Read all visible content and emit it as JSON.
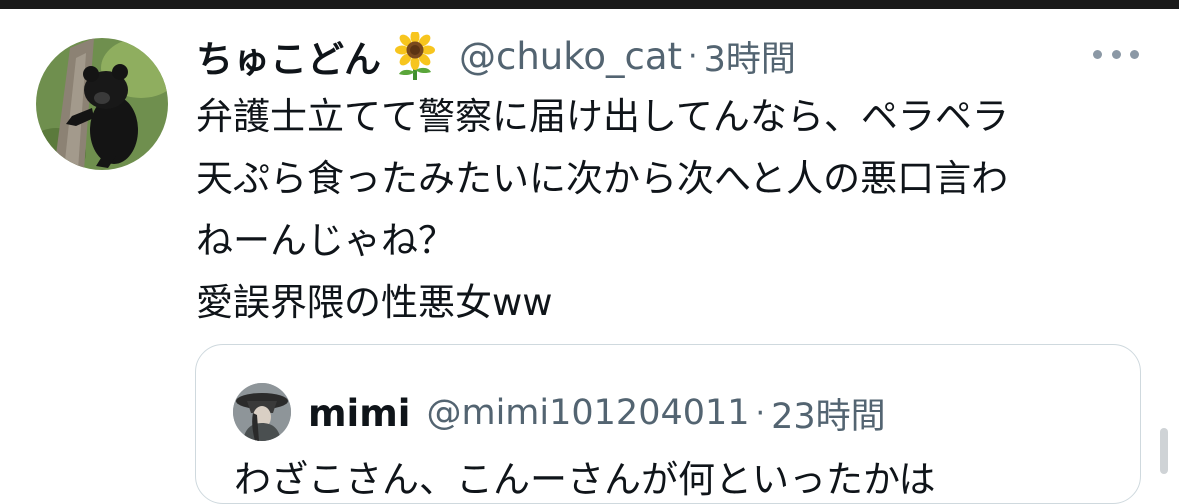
{
  "tweet": {
    "display_name": "ちゅこどん",
    "name_emoji": "sunflower-icon",
    "handle": "@chuko_cat",
    "separator": "·",
    "time": "3時間",
    "text_lines": [
      "弁護士立てて警察に届け出してんなら、ペラペラ",
      "天ぷら食ったみたいに次から次へと人の悪口言わ",
      "ねーんじゃね？",
      "愛誤界隈の性悪女ww"
    ]
  },
  "quote": {
    "display_name": "mimi",
    "handle": "@mimi101204011",
    "separator": "·",
    "time": "23時間",
    "text_partial": "わざこさん、こんーさんが何といったかは"
  },
  "colors": {
    "text_primary": "#0f1419",
    "text_secondary": "#536471",
    "border": "#cfd9de",
    "top_bar": "#1a1a1a"
  }
}
